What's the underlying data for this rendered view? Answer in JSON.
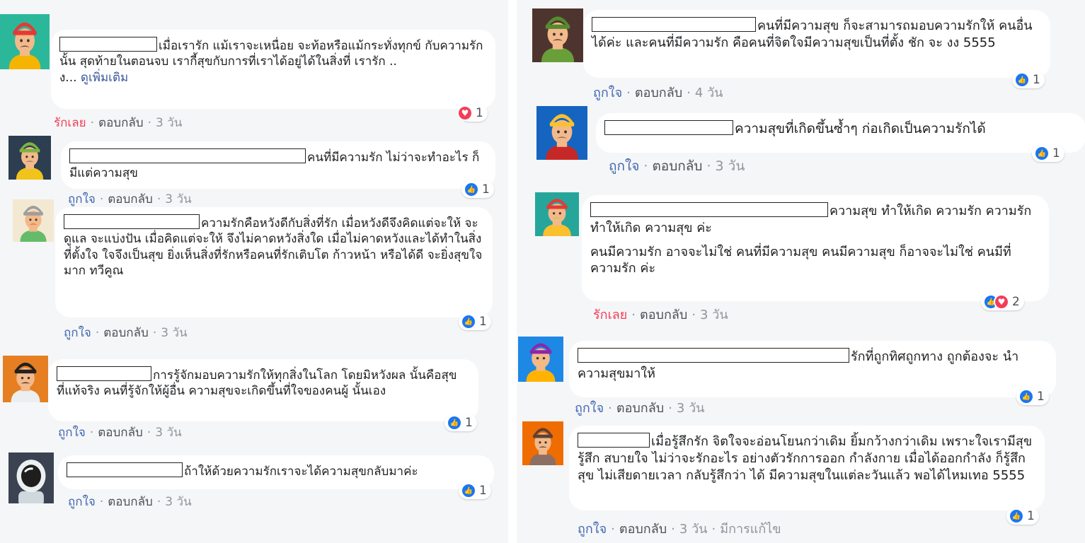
{
  "actions": {
    "like": "ถูกใจ",
    "love": "รักเลย",
    "reply": "ตอบกลับ",
    "edited": "มีการแก้ไข",
    "separator": "·"
  },
  "colors": {
    "like_blue": "#4267b2",
    "love_red": "#f33e58",
    "bubble_bg": "#ffffff",
    "page_bg": "#f5f6f7",
    "meta_gray": "#90949c"
  },
  "comments": [
    {
      "avatar": "firefighter-avatar",
      "text": [
        "เมื่อเรารัก แม้เราจะเหนื่อย จะท้อหรือแม้กระทั่งทุกข์ กับความรักนั้น สุดท้ายในตอนจบ เรากี้สุขกับการที่เราได้อยู่ได้ในสิ่งที่ เรารัก .."
      ],
      "see_more_prefix": "ง...",
      "see_more": "ดูเพิ่มเติม",
      "reaction": "รักเลย",
      "time": "3 วัน",
      "reactions": [
        "love"
      ],
      "count": "1"
    },
    {
      "avatar": "scout-avatar",
      "text": [
        "คนที่มีความรัก ไม่ว่าจะทำอะไร ก็มีแต่ความสุข"
      ],
      "reaction": "ถูกใจ",
      "time": "3 วัน",
      "reactions": [
        "like"
      ],
      "count": "1"
    },
    {
      "avatar": "viking-avatar",
      "text": [
        "ความรักคือหวังดีกับสิ่งที่รัก เมื่อหวังดีจึงคิดแต่จะให้ จะดูแล จะแบ่งปัน เมื่อคิดแต่จะให้ จึงไม่คาดหวังสิ่งใด เมื่อไม่คาดหวังและได้ทำในสิ่งที่ตั้งใจ ใจจึงเป็นสุข ยิ่งเห็นสิ่งที่รักหรือคนที่รักเติบโต ก้าวหน้า หรือได้ดี จะยิ่งสุขใจมาก ทวีคูณ"
      ],
      "reaction": "ถูกใจ",
      "time": "3 วัน",
      "reactions": [
        "like"
      ],
      "count": "1"
    },
    {
      "avatar": "pirate-avatar",
      "text": [
        "การรู้จักมอบความรักให้ทุกสิ่งในโลก โดยมิหวังผล นั้นคือสุขที่แท้จริง คนที่รู้จักให้ผู้อื่น ความสุขจะเกิดขึ้นที่ใจของคนผู้ นั้นเอง"
      ],
      "reaction": "ถูกใจ",
      "time": "3 วัน",
      "reactions": [
        "like"
      ],
      "count": "1"
    },
    {
      "avatar": "astronaut-avatar",
      "text": [
        "ถ้าให้ด้วยความรักเราจะได้ความสุขกลับมาค่ะ"
      ],
      "reaction": "ถูกใจ",
      "time": "3 วัน",
      "reactions": [
        "like"
      ],
      "count": "1"
    },
    {
      "avatar": "soldier-avatar",
      "text": [
        "คนที่มีความสุข ก็จะสามารถมอบความรักให้ คนอื่นได้ค่ะ และคนที่มีความรัก คือคนที่จิตใจมีความสุขเป็นที่ตั้ง ชัก จะ งง 5555"
      ],
      "reaction": "ถูกใจ",
      "time": "4 วัน",
      "reactions": [
        "like"
      ],
      "count": "1"
    },
    {
      "avatar": "king-avatar",
      "text": [
        "ความสุขที่เกิดขึ้นซ้ำๆ ก่อเกิดเป็นความรักได้"
      ],
      "reaction": "ถูกใจ",
      "time": "3 วัน",
      "reactions": [
        "like"
      ],
      "count": "1"
    },
    {
      "avatar": "roman-avatar",
      "text": [
        "ความสุข ทำให้เกิด ความรัก ความรัก ทำให้เกิด ความสุข ค่ะ",
        "คนมีความรัก อาจจะไม่ใช่ คนที่มีความสุข คนมีความสุข ก็อาจจะไม่ใช่ คนมีที่ความรัก ค่ะ"
      ],
      "reaction": "รักเลย",
      "time": "3 วัน",
      "reactions": [
        "like",
        "love"
      ],
      "count": "2"
    },
    {
      "avatar": "cyclist-avatar",
      "text": [
        "รักที่ถูกทิศถูกทาง ถูกต้องจะ นำความสุขมาให้"
      ],
      "reaction": "ถูกใจ",
      "time": "3 วัน",
      "reactions": [
        "like"
      ],
      "count": "1"
    },
    {
      "avatar": "pilot-avatar",
      "text": [
        "เมื่อรู้สึกรัก จิตใจจะอ่อนโยนกว่าเดิม ยิ้มกว้างกว่าเดิม เพราะใจเรามีสุข รู้สึก สบายใจ ไม่ว่าจะรักอะไร อย่างตัวรักการออก กำลังกาย เมื่อได้ออกกำลัง ก็รู้สึกสุข ไม่เสียดายเวลา กลับรู้สึกว่า ได้ มีความสุขในแต่ละวันแล้ว พอได้ไหมเทอ 5555"
      ],
      "reaction": "ถูกใจ",
      "time": "3 วัน",
      "edited": true,
      "reactions": [
        "like"
      ],
      "count": "1"
    }
  ]
}
